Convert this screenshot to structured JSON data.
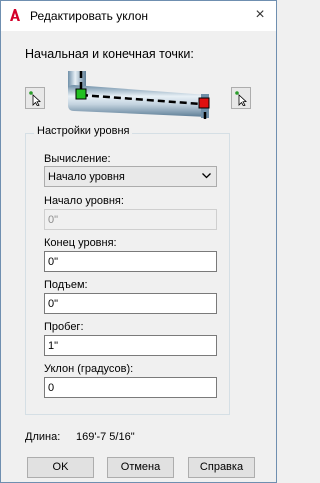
{
  "window": {
    "title": "Редактировать уклон",
    "icon": "autocad-icon",
    "close": "×",
    "accent": "#d4002a"
  },
  "endpoints": {
    "title": "Начальная и конечная точки:"
  },
  "group": {
    "title": "Настройки уровня",
    "calc_label": "Вычисление:",
    "calc_value": "Начало уровня",
    "start_label": "Начало уровня:",
    "start_value": "0\"",
    "end_label": "Конец уровня:",
    "end_value": "0\"",
    "rise_label": "Подъем:",
    "rise_value": "0\"",
    "run_label": "Пробег:",
    "run_value": "1\"",
    "slope_label": "Уклон (градусов):",
    "slope_value": "0"
  },
  "length": {
    "label": "Длина:",
    "value": "169'-7 5/16\""
  },
  "buttons": {
    "ok": "OK",
    "cancel": "Отмена",
    "help": "Справка"
  }
}
